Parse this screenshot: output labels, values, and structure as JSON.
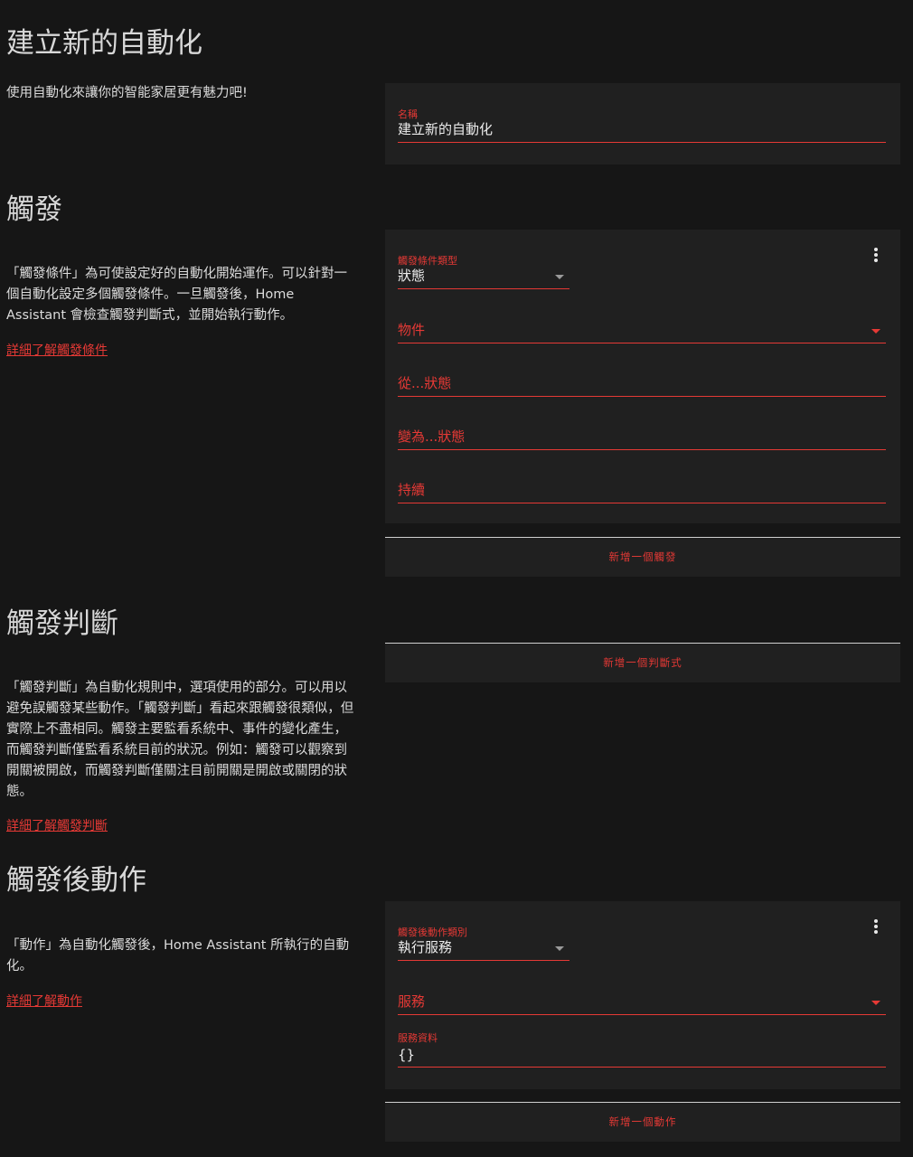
{
  "header": {
    "title": "建立新的自動化",
    "intro": "使用自動化來讓你的智能家居更有魅力吧!"
  },
  "name_card": {
    "label": "名稱",
    "value": "建立新的自動化"
  },
  "triggers": {
    "title": "觸發",
    "description": "「觸發條件」為可使設定好的自動化開始運作。可以針對一個自動化設定多個觸發條件。一旦觸發後，Home Assistant 會檢查觸發判斷式，並開始執行動作。",
    "learn_more": "詳細了解觸發條件",
    "card": {
      "type_label": "觸發條件類型",
      "type_value": "狀態",
      "entity_placeholder": "物件",
      "from_placeholder": "從...狀態",
      "to_placeholder": "變為...狀態",
      "for_placeholder": "持續"
    },
    "add_button": "新增一個觸發"
  },
  "conditions": {
    "title": "觸發判斷",
    "description": "「觸發判斷」為自動化規則中，選項使用的部分。可以用以避免誤觸發某些動作。「觸發判斷」看起來跟觸發很類似，但實際上不盡相同。觸發主要監看系統中、事件的變化產生，而觸發判斷僅監看系統目前的狀況。例如：觸發可以觀察到開關被開啟，而觸發判斷僅關注目前開關是開啟或關閉的狀態。",
    "learn_more": "詳細了解觸發判斷",
    "add_button": "新增一個判斷式"
  },
  "actions": {
    "title": "觸發後動作",
    "description": "「動作」為自動化觸發後，Home Assistant 所執行的自動化。",
    "learn_more": "詳細了解動作",
    "card": {
      "type_label": "觸發後動作類別",
      "type_value": "執行服務",
      "service_placeholder": "服務",
      "data_label": "服務資料",
      "data_value": "{}"
    },
    "add_button": "新增一個動作"
  },
  "colors": {
    "accent": "#e53935",
    "background": "#161616",
    "card": "#202020"
  }
}
